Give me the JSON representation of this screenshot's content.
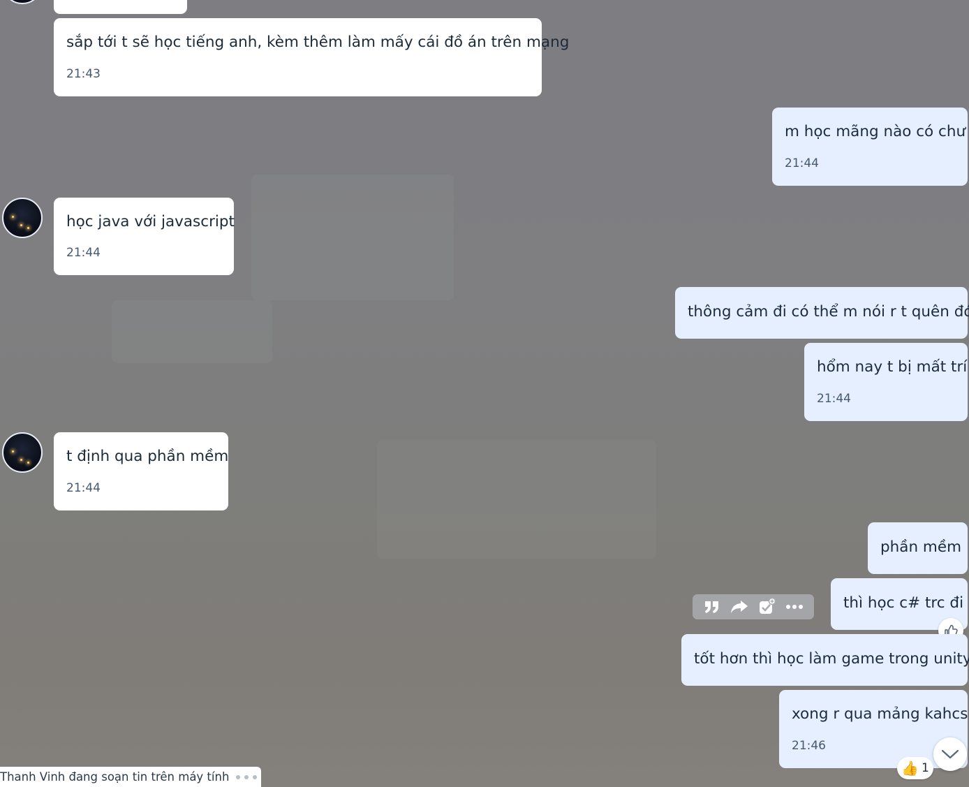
{
  "messages": [
    {
      "direction": "in",
      "text": "sắp tới t sẽ học tiếng anh, kèm thêm làm mấy cái đồ án trên mạng",
      "time": "21:43"
    },
    {
      "direction": "out",
      "text": "m học mãng nào có chư",
      "time": "21:44"
    },
    {
      "direction": "in",
      "text": "học java với javascript",
      "time": "21:44"
    },
    {
      "direction": "out",
      "text": "thông cảm đi có thể m nói r t quên đó",
      "time": ""
    },
    {
      "direction": "out",
      "text": "hổm nay t bị mất trí",
      "time": "21:44"
    },
    {
      "direction": "in",
      "text": "t định qua phần mềm",
      "time": "21:44"
    },
    {
      "direction": "out",
      "text": "phần mềm",
      "time": ""
    },
    {
      "direction": "out",
      "text": "thì học c# trc đi",
      "time": ""
    },
    {
      "direction": "out",
      "text": "tốt hơn thì học làm game trong unity",
      "time": ""
    },
    {
      "direction": "out",
      "text": "xong r qua mảng kahcs",
      "time": "21:46"
    }
  ],
  "hover_toolbar": {
    "icons": [
      "quote-icon",
      "forward-icon",
      "add-task-icon",
      "more-icon"
    ]
  },
  "reaction": {
    "emoji": "👍",
    "count": "1"
  },
  "typing_indicator": {
    "text": "Thanh Vinh đang soạn tin trên máy tính"
  },
  "colors": {
    "incoming_bubble": "#ffffff",
    "outgoing_bubble": "#e5efff",
    "timestamp": "#46586e",
    "text": "#1c2b3a"
  }
}
